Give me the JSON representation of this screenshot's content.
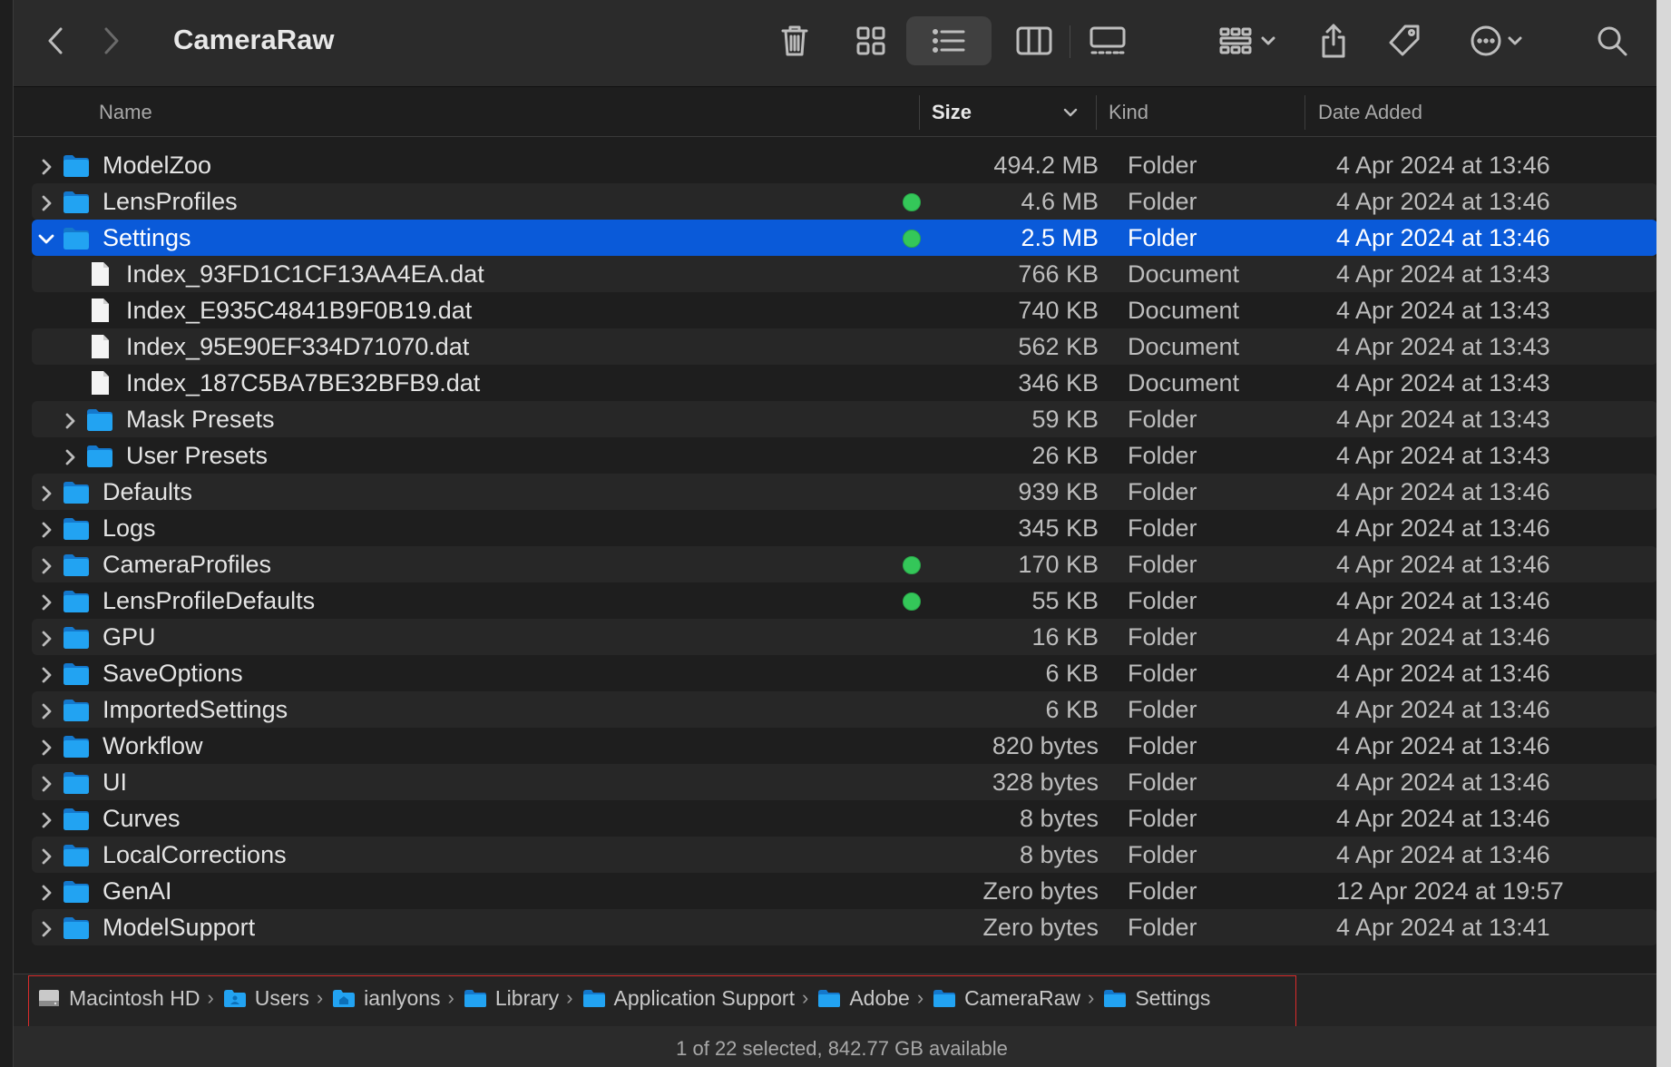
{
  "window": {
    "title": "CameraRaw"
  },
  "toolbar": {
    "back": "back",
    "forward": "forward",
    "icons": [
      "trash-icon",
      "icon-view-icon",
      "list-view-icon",
      "column-view-icon",
      "gallery-view-icon",
      "group-icon",
      "share-icon",
      "tag-icon",
      "more-icon",
      "search-icon"
    ],
    "active_view": "list"
  },
  "columns": {
    "name": "Name",
    "size": "Size",
    "kind": "Kind",
    "date_added": "Date Added",
    "sorted_by": "size",
    "sort_dir": "desc"
  },
  "rows": [
    {
      "name": "ModelZoo",
      "type": "folder",
      "depth": 0,
      "expanded": false,
      "tag": false,
      "size": "494.2 MB",
      "kind": "Folder",
      "date": "4 Apr 2024 at 13:46"
    },
    {
      "name": "LensProfiles",
      "type": "folder",
      "depth": 0,
      "expanded": false,
      "tag": true,
      "size": "4.6 MB",
      "kind": "Folder",
      "date": "4 Apr 2024 at 13:46"
    },
    {
      "name": "Settings",
      "type": "folder",
      "depth": 0,
      "expanded": true,
      "tag": true,
      "selected": true,
      "size": "2.5 MB",
      "kind": "Folder",
      "date": "4 Apr 2024 at 13:46"
    },
    {
      "name": "Index_93FD1C1CF13AA4EA.dat",
      "type": "file",
      "depth": 1,
      "tag": false,
      "size": "766 KB",
      "kind": "Document",
      "date": "4 Apr 2024 at 13:43"
    },
    {
      "name": "Index_E935C4841B9F0B19.dat",
      "type": "file",
      "depth": 1,
      "tag": false,
      "size": "740 KB",
      "kind": "Document",
      "date": "4 Apr 2024 at 13:43"
    },
    {
      "name": "Index_95E90EF334D71070.dat",
      "type": "file",
      "depth": 1,
      "tag": false,
      "size": "562 KB",
      "kind": "Document",
      "date": "4 Apr 2024 at 13:43"
    },
    {
      "name": "Index_187C5BA7BE32BFB9.dat",
      "type": "file",
      "depth": 1,
      "tag": false,
      "size": "346 KB",
      "kind": "Document",
      "date": "4 Apr 2024 at 13:43"
    },
    {
      "name": "Mask Presets",
      "type": "folder",
      "depth": 1,
      "expanded": false,
      "tag": false,
      "size": "59 KB",
      "kind": "Folder",
      "date": "4 Apr 2024 at 13:43"
    },
    {
      "name": "User Presets",
      "type": "folder",
      "depth": 1,
      "expanded": false,
      "tag": false,
      "size": "26 KB",
      "kind": "Folder",
      "date": "4 Apr 2024 at 13:43"
    },
    {
      "name": "Defaults",
      "type": "folder",
      "depth": 0,
      "expanded": false,
      "tag": false,
      "size": "939 KB",
      "kind": "Folder",
      "date": "4 Apr 2024 at 13:46"
    },
    {
      "name": "Logs",
      "type": "folder",
      "depth": 0,
      "expanded": false,
      "tag": false,
      "size": "345 KB",
      "kind": "Folder",
      "date": "4 Apr 2024 at 13:46"
    },
    {
      "name": "CameraProfiles",
      "type": "folder",
      "depth": 0,
      "expanded": false,
      "tag": true,
      "size": "170 KB",
      "kind": "Folder",
      "date": "4 Apr 2024 at 13:46"
    },
    {
      "name": "LensProfileDefaults",
      "type": "folder",
      "depth": 0,
      "expanded": false,
      "tag": true,
      "size": "55 KB",
      "kind": "Folder",
      "date": "4 Apr 2024 at 13:46"
    },
    {
      "name": "GPU",
      "type": "folder",
      "depth": 0,
      "expanded": false,
      "tag": false,
      "size": "16 KB",
      "kind": "Folder",
      "date": "4 Apr 2024 at 13:46"
    },
    {
      "name": "SaveOptions",
      "type": "folder",
      "depth": 0,
      "expanded": false,
      "tag": false,
      "size": "6 KB",
      "kind": "Folder",
      "date": "4 Apr 2024 at 13:46"
    },
    {
      "name": "ImportedSettings",
      "type": "folder",
      "depth": 0,
      "expanded": false,
      "tag": false,
      "size": "6 KB",
      "kind": "Folder",
      "date": "4 Apr 2024 at 13:46"
    },
    {
      "name": "Workflow",
      "type": "folder",
      "depth": 0,
      "expanded": false,
      "tag": false,
      "size": "820 bytes",
      "kind": "Folder",
      "date": "4 Apr 2024 at 13:46"
    },
    {
      "name": "UI",
      "type": "folder",
      "depth": 0,
      "expanded": false,
      "tag": false,
      "size": "328 bytes",
      "kind": "Folder",
      "date": "4 Apr 2024 at 13:46"
    },
    {
      "name": "Curves",
      "type": "folder",
      "depth": 0,
      "expanded": false,
      "tag": false,
      "size": "8 bytes",
      "kind": "Folder",
      "date": "4 Apr 2024 at 13:46"
    },
    {
      "name": "LocalCorrections",
      "type": "folder",
      "depth": 0,
      "expanded": false,
      "tag": false,
      "size": "8 bytes",
      "kind": "Folder",
      "date": "4 Apr 2024 at 13:46"
    },
    {
      "name": "GenAI",
      "type": "folder",
      "depth": 0,
      "expanded": false,
      "tag": false,
      "size": "Zero bytes",
      "kind": "Folder",
      "date": "12 Apr 2024 at 19:57"
    },
    {
      "name": "ModelSupport",
      "type": "folder",
      "depth": 0,
      "expanded": false,
      "tag": false,
      "size": "Zero bytes",
      "kind": "Folder",
      "date": "4 Apr 2024 at 13:41"
    }
  ],
  "path": [
    {
      "label": "Macintosh HD",
      "icon": "hard-drive-icon"
    },
    {
      "label": "Users",
      "icon": "users-folder-icon"
    },
    {
      "label": "ianlyons",
      "icon": "home-folder-icon"
    },
    {
      "label": "Library",
      "icon": "folder-icon"
    },
    {
      "label": "Application Support",
      "icon": "folder-icon"
    },
    {
      "label": "Adobe",
      "icon": "folder-icon"
    },
    {
      "label": "CameraRaw",
      "icon": "folder-icon"
    },
    {
      "label": "Settings",
      "icon": "folder-icon"
    }
  ],
  "status": "1 of 22 selected, 842.77 GB available",
  "colors": {
    "selection": "#0a5ad9",
    "tag_green": "#34c759",
    "folder_blue": "#1e9bf0"
  }
}
